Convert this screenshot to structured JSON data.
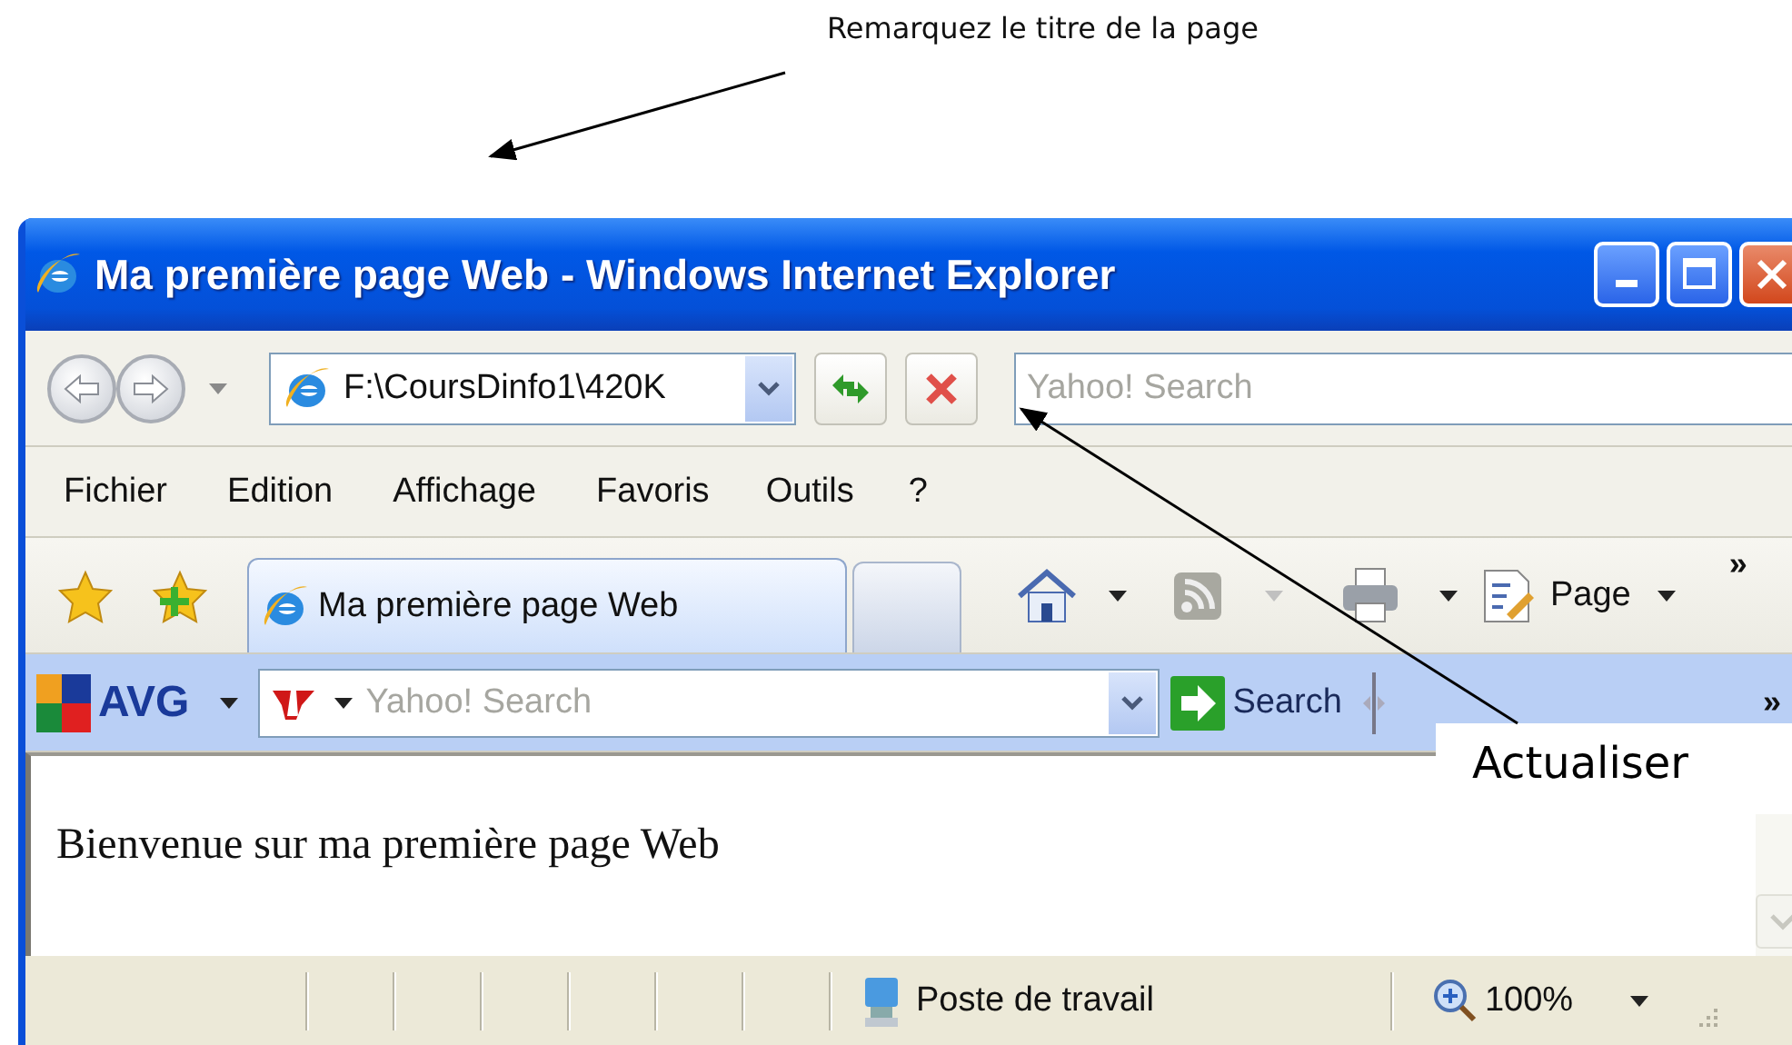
{
  "annotations": [
    {
      "kind": "title-note",
      "text": "Remarquez le titre de la page"
    },
    {
      "kind": "button-note",
      "text": "Actualiser"
    }
  ],
  "window": {
    "title": "Ma première page Web - Windows Internet Explorer"
  },
  "address_bar": {
    "value": "F:\\CoursDinfo1\\420K"
  },
  "search": {
    "placeholder": "Yahoo! Search"
  },
  "menu": [
    {
      "label": "Fichier"
    },
    {
      "label": "Edition"
    },
    {
      "label": "Affichage"
    },
    {
      "label": "Favoris"
    },
    {
      "label": "Outils"
    },
    {
      "label": "?"
    }
  ],
  "tabs": [
    {
      "label": "Ma première page Web",
      "selected": true
    }
  ],
  "command_bar": {
    "page_menu": "Page",
    "overflow": "»"
  },
  "avg_toolbar": {
    "logo": "AVG",
    "search_placeholder": "Yahoo! Search",
    "search_button": "Search",
    "overflow": "»"
  },
  "page": {
    "text": "Bienvenue sur ma première page Web"
  },
  "status_bar": {
    "zone": "Poste de travail",
    "zoom": "100%"
  }
}
